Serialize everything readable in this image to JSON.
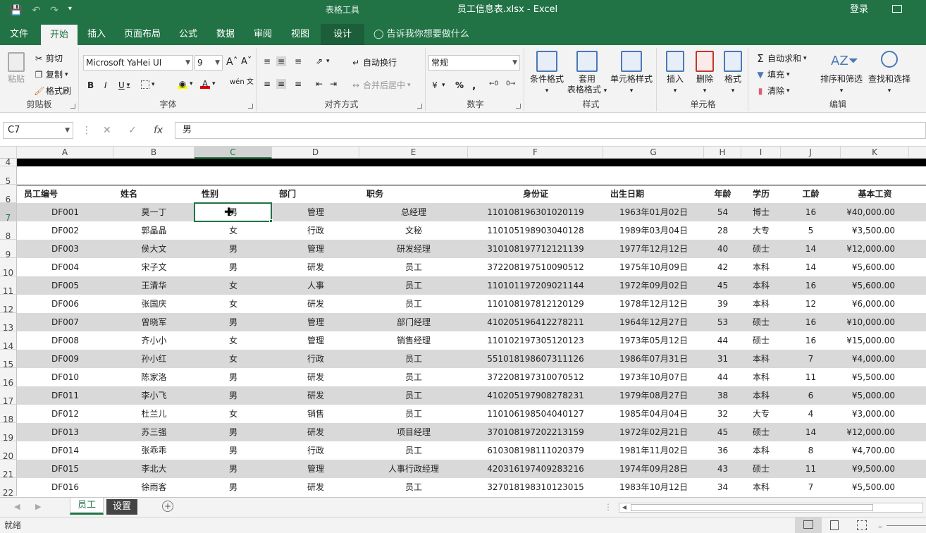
{
  "titlebar": {
    "ctx_tools": "表格工具",
    "doc_title": "员工信息表.xlsx  -  Excel",
    "login": "登录"
  },
  "tabs": [
    "文件",
    "开始",
    "插入",
    "页面布局",
    "公式",
    "数据",
    "审阅",
    "视图",
    "设计"
  ],
  "tellme": "告诉我你想要做什么",
  "ribbon": {
    "clipboard": {
      "label": "剪贴板",
      "paste": "粘贴",
      "cut": "剪切",
      "copy": "复制",
      "format_painter": "格式刷"
    },
    "font": {
      "label": "字体",
      "font_name": "Microsoft YaHei UI",
      "font_size": "9",
      "bold": "B",
      "italic": "I",
      "underline": "U",
      "wen": "wén 文"
    },
    "align": {
      "label": "对齐方式",
      "wrap": "自动换行",
      "merge": "合并后居中"
    },
    "number": {
      "label": "数字",
      "format": "常规"
    },
    "styles": {
      "label": "样式",
      "cond": "条件格式",
      "table_line1": "套用",
      "table_line2": "表格格式",
      "cell": "单元格样式"
    },
    "cells": {
      "label": "单元格",
      "insert": "插入",
      "delete": "删除",
      "format": "格式"
    },
    "edit": {
      "label": "编辑",
      "autosum": "自动求和",
      "fill": "填充",
      "clear": "清除",
      "sort": "排序和筛选",
      "find": "查找和选择"
    }
  },
  "formula": {
    "namebox": "C7",
    "value": "男"
  },
  "columns": [
    "A",
    "B",
    "C",
    "D",
    "E",
    "F",
    "G",
    "H",
    "I",
    "J",
    "K"
  ],
  "selected_col": "C",
  "selected_row": "7",
  "headers": [
    "员工编号",
    "姓名",
    "性别",
    "部门",
    "职务",
    "身份证",
    "出生日期",
    "年龄",
    "学历",
    "工龄",
    "基本工资"
  ],
  "rows": [
    [
      "DF001",
      "莫一丁",
      "男",
      "管理",
      "总经理",
      "110108196301020119",
      "1963年01月02日",
      "54",
      "博士",
      "16",
      "¥40,000.00"
    ],
    [
      "DF002",
      "郭晶晶",
      "女",
      "行政",
      "文秘",
      "110105198903040128",
      "1989年03月04日",
      "28",
      "大专",
      "5",
      "¥3,500.00"
    ],
    [
      "DF003",
      "侯大文",
      "男",
      "管理",
      "研发经理",
      "310108197712121139",
      "1977年12月12日",
      "40",
      "硕士",
      "14",
      "¥12,000.00"
    ],
    [
      "DF004",
      "宋子文",
      "男",
      "研发",
      "员工",
      "372208197510090512",
      "1975年10月09日",
      "42",
      "本科",
      "14",
      "¥5,600.00"
    ],
    [
      "DF005",
      "王清华",
      "女",
      "人事",
      "员工",
      "110101197209021144",
      "1972年09月02日",
      "45",
      "本科",
      "16",
      "¥5,600.00"
    ],
    [
      "DF006",
      "张国庆",
      "女",
      "研发",
      "员工",
      "110108197812120129",
      "1978年12月12日",
      "39",
      "本科",
      "12",
      "¥6,000.00"
    ],
    [
      "DF007",
      "曾晓军",
      "男",
      "管理",
      "部门经理",
      "410205196412278211",
      "1964年12月27日",
      "53",
      "硕士",
      "16",
      "¥10,000.00"
    ],
    [
      "DF008",
      "齐小小",
      "女",
      "管理",
      "销售经理",
      "110102197305120123",
      "1973年05月12日",
      "44",
      "硕士",
      "16",
      "¥15,000.00"
    ],
    [
      "DF009",
      "孙小红",
      "女",
      "行政",
      "员工",
      "551018198607311126",
      "1986年07月31日",
      "31",
      "本科",
      "7",
      "¥4,000.00"
    ],
    [
      "DF010",
      "陈家洛",
      "男",
      "研发",
      "员工",
      "372208197310070512",
      "1973年10月07日",
      "44",
      "本科",
      "11",
      "¥5,500.00"
    ],
    [
      "DF011",
      "李小飞",
      "男",
      "研发",
      "员工",
      "410205197908278231",
      "1979年08月27日",
      "38",
      "本科",
      "6",
      "¥5,000.00"
    ],
    [
      "DF012",
      "杜兰儿",
      "女",
      "销售",
      "员工",
      "110106198504040127",
      "1985年04月04日",
      "32",
      "大专",
      "4",
      "¥3,000.00"
    ],
    [
      "DF013",
      "苏三强",
      "男",
      "研发",
      "项目经理",
      "370108197202213159",
      "1972年02月21日",
      "45",
      "硕士",
      "14",
      "¥12,000.00"
    ],
    [
      "DF014",
      "张乖乖",
      "男",
      "行政",
      "员工",
      "610308198111020379",
      "1981年11月02日",
      "36",
      "本科",
      "8",
      "¥4,700.00"
    ],
    [
      "DF015",
      "李北大",
      "男",
      "管理",
      "人事行政经理",
      "420316197409283216",
      "1974年09月28日",
      "43",
      "硕士",
      "11",
      "¥9,500.00"
    ],
    [
      "DF016",
      "徐雨客",
      "男",
      "研发",
      "员工",
      "327018198310123015",
      "1983年10月12日",
      "34",
      "本科",
      "7",
      "¥5,500.00"
    ]
  ],
  "row_numbers": [
    "4",
    "5",
    "6",
    "7",
    "8",
    "9",
    "10",
    "11",
    "12",
    "13",
    "14",
    "15",
    "16",
    "17",
    "18",
    "19",
    "20",
    "21",
    "22"
  ],
  "sheets": [
    "员工",
    "设置"
  ],
  "status": "就绪",
  "colors": {
    "brand": "#217346",
    "band": "#d9d9d9"
  }
}
